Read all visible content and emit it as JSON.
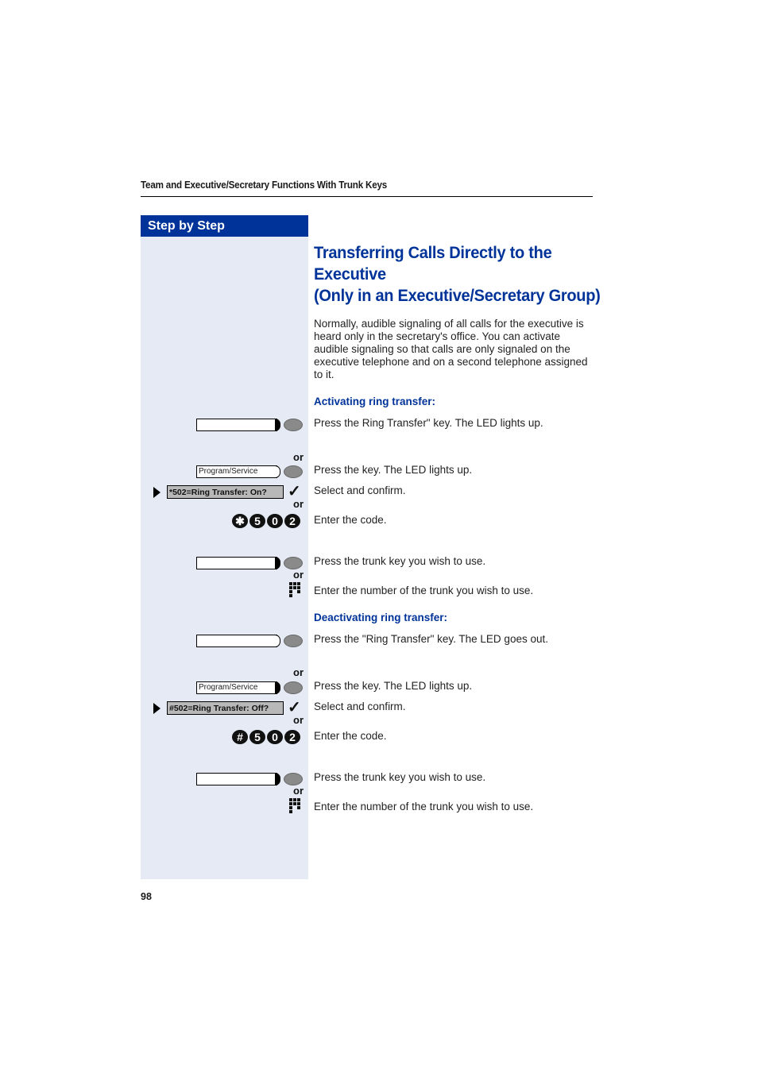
{
  "header": {
    "running_title": "Team and Executive/Secretary Functions With Trunk Keys"
  },
  "sidebar": {
    "heading": "Step by Step"
  },
  "main": {
    "title_lines": [
      "Transferring Calls Directly to the",
      "Executive",
      "(Only in an Executive/Secretary Group)"
    ],
    "intro": "Normally, audible signaling of all calls for the executive is heard only in the secretary's office. You can activate audible signaling so that calls are only signaled on the executive telephone and on a second telephone assigned to it.",
    "activating": {
      "heading": "Activating ring transfer:",
      "steps": [
        "Press the Ring Transfer\" key. The LED lights up.",
        "Press the key. The LED lights up.",
        "Select and confirm.",
        "Enter the code.",
        "Press the trunk key you wish to use.",
        "Enter the number of the trunk you wish to use."
      ],
      "program_key_label": "Program/Service",
      "display_text": "*502=Ring Transfer: On?",
      "code_keys": [
        "✱",
        "5",
        "0",
        "2"
      ]
    },
    "deactivating": {
      "heading": "Deactivating ring transfer:",
      "steps": [
        "Press the \"Ring Transfer\" key. The LED goes out.",
        "Press the key. The LED lights up.",
        "Select and confirm.",
        "Enter the code.",
        "Press the trunk key you wish to use.",
        "Enter the number of the trunk you wish to use."
      ],
      "program_key_label": "Program/Service",
      "display_text": "#502=Ring Transfer: Off?",
      "code_keys": [
        "#",
        "5",
        "0",
        "2"
      ]
    },
    "or_label": "or",
    "check_glyph": "✓"
  },
  "footer": {
    "page_number": "98"
  }
}
